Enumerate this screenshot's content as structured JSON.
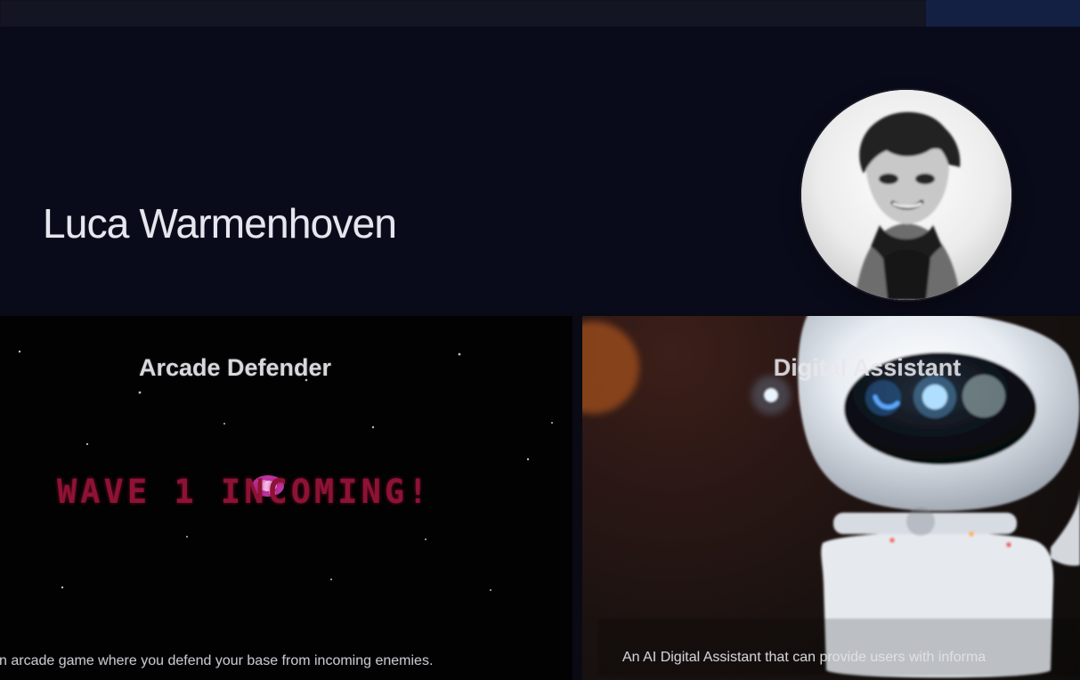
{
  "header": {
    "name": "Luca Warmenhoven",
    "avatar_icon": "portrait-avatar-icon"
  },
  "projects": [
    {
      "title": "Arcade Defender",
      "game_text": "WAVE 1 INCOMING!",
      "description": "n arcade game where you defend your base from incoming enemies."
    },
    {
      "title": "Digital Assistant",
      "description": "An AI Digital Assistant that can provide users with informa"
    }
  ],
  "colors": {
    "background": "#0a0a14",
    "hero": "#0a0b1a",
    "top_bar": "#141522",
    "accent_bar": "#132043",
    "arcade_text": "#8e1234"
  }
}
